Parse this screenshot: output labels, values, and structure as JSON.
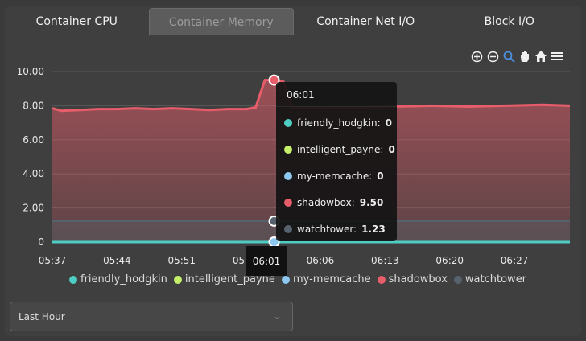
{
  "tabs": [
    {
      "label": "Container CPU",
      "active": false
    },
    {
      "label": "Container Memory",
      "active": true
    },
    {
      "label": "Container Net I/O",
      "active": false
    },
    {
      "label": "Block I/O",
      "active": false
    }
  ],
  "toolbar": {
    "icons": [
      "zoom-in-icon",
      "zoom-out-icon",
      "zoom-select-icon",
      "pan-icon",
      "home-icon",
      "menu-icon"
    ]
  },
  "tooltip": {
    "time": "06:01",
    "rows": [
      {
        "name": "friendly_hodgkin:",
        "value": "0",
        "color": "#4ecdc4"
      },
      {
        "name": "intelligent_payne:",
        "value": "0",
        "color": "#c6f06a"
      },
      {
        "name": "my-memcache:",
        "value": "0",
        "color": "#8cc8f0"
      },
      {
        "name": "shadowbox:",
        "value": "9.50",
        "color": "#e85d6a"
      },
      {
        "name": "watchtower:",
        "value": "1.23",
        "color": "#56636e"
      }
    ]
  },
  "hover_x_label": "06:01",
  "range_select": {
    "value": "Last Hour"
  },
  "chart_data": {
    "type": "area",
    "x_ticks": [
      "05:37",
      "05:44",
      "05:51",
      "05:58",
      "06:06",
      "06:13",
      "06:20",
      "06:27"
    ],
    "y_ticks": [
      "10.00",
      "8.00",
      "6.00",
      "4.00",
      "2.00",
      "0"
    ],
    "ylim": [
      0,
      10
    ],
    "x": [
      "05:37",
      "05:38",
      "05:40",
      "05:42",
      "05:44",
      "05:46",
      "05:48",
      "05:50",
      "05:52",
      "05:54",
      "05:56",
      "05:58",
      "05:59",
      "06:00",
      "06:01",
      "06:02",
      "06:03",
      "06:04",
      "06:06",
      "06:10",
      "06:14",
      "06:18",
      "06:22",
      "06:26",
      "06:30",
      "06:33"
    ],
    "series": [
      {
        "name": "friendly_hodgkin",
        "color": "#4ecdc4",
        "values": [
          0,
          0,
          0,
          0,
          0,
          0,
          0,
          0,
          0,
          0,
          0,
          0,
          0,
          0,
          0,
          0,
          0,
          0,
          0,
          0,
          0,
          0,
          0,
          0,
          0,
          0
        ]
      },
      {
        "name": "intelligent_payne",
        "color": "#c6f06a",
        "values": [
          0,
          0,
          0,
          0,
          0,
          0,
          0,
          0,
          0,
          0,
          0,
          0,
          0,
          0,
          0,
          0,
          0,
          0,
          0,
          0,
          0,
          0,
          0,
          0,
          0,
          0
        ]
      },
      {
        "name": "my-memcache",
        "color": "#8cc8f0",
        "values": [
          0,
          0,
          0,
          0,
          0,
          0,
          0,
          0,
          0,
          0,
          0,
          0,
          0,
          0,
          0,
          0,
          0,
          0,
          0,
          0,
          0,
          0,
          0,
          0,
          0,
          0
        ]
      },
      {
        "name": "shadowbox",
        "color": "#e85d6a",
        "values": [
          7.85,
          7.7,
          7.75,
          7.8,
          7.8,
          7.85,
          7.8,
          7.85,
          7.8,
          7.75,
          7.8,
          7.8,
          7.9,
          9.5,
          9.5,
          9.4,
          7.9,
          7.9,
          7.85,
          7.9,
          7.95,
          8.0,
          7.95,
          8.0,
          8.05,
          8.0
        ]
      },
      {
        "name": "watchtower",
        "color": "#56636e",
        "values": [
          1.23,
          1.23,
          1.23,
          1.23,
          1.23,
          1.23,
          1.23,
          1.23,
          1.23,
          1.23,
          1.23,
          1.23,
          1.23,
          1.23,
          1.23,
          1.23,
          1.23,
          1.23,
          1.23,
          1.23,
          1.23,
          1.23,
          1.23,
          1.23,
          1.23,
          1.23
        ]
      }
    ],
    "legend_position": "bottom"
  }
}
